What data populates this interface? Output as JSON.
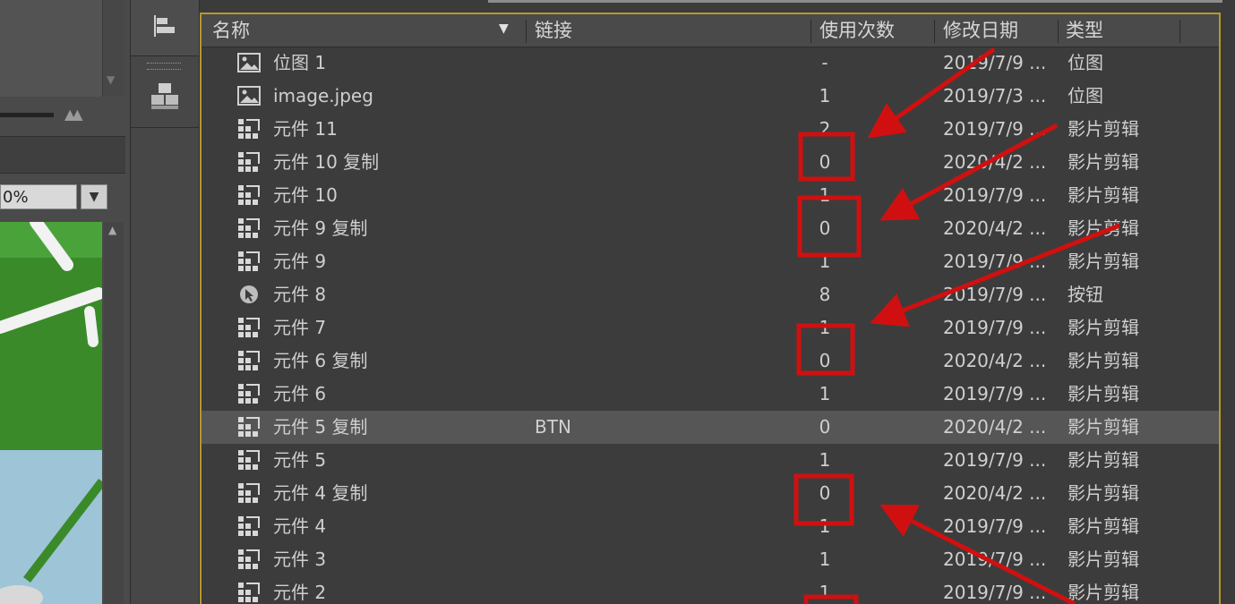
{
  "colors": {
    "panel_border": "#b8962e",
    "annotation_red": "#d01010",
    "selected_row": "#565656"
  },
  "left_panel": {
    "zoom_value": "0%",
    "zoom_dropdown_icon": "chevron-down-icon"
  },
  "library": {
    "columns": {
      "name": "名称",
      "linkage": "链接",
      "use_count": "使用次数",
      "modified": "修改日期",
      "type": "类型"
    },
    "rows": [
      {
        "icon": "bitmap",
        "name": "位图 1",
        "linkage": "",
        "use_count": "-",
        "modified": "2019/7/9 ...",
        "type": "位图",
        "selected": false
      },
      {
        "icon": "bitmap",
        "name": "image.jpeg",
        "linkage": "",
        "use_count": "1",
        "modified": "2019/7/3 ...",
        "type": "位图",
        "selected": false
      },
      {
        "icon": "movieclip",
        "name": "元件 11",
        "linkage": "",
        "use_count": "2",
        "modified": "2019/7/9 ...",
        "type": "影片剪辑",
        "selected": false
      },
      {
        "icon": "movieclip",
        "name": "元件 10 复制",
        "linkage": "",
        "use_count": "0",
        "modified": "2020/4/2 ...",
        "type": "影片剪辑",
        "selected": false
      },
      {
        "icon": "movieclip",
        "name": "元件 10",
        "linkage": "",
        "use_count": "1",
        "modified": "2019/7/9 ...",
        "type": "影片剪辑",
        "selected": false
      },
      {
        "icon": "movieclip",
        "name": "元件 9 复制",
        "linkage": "",
        "use_count": "0",
        "modified": "2020/4/2 ...",
        "type": "影片剪辑",
        "selected": false
      },
      {
        "icon": "movieclip",
        "name": "元件 9",
        "linkage": "",
        "use_count": "1",
        "modified": "2019/7/9 ...",
        "type": "影片剪辑",
        "selected": false
      },
      {
        "icon": "button",
        "name": "元件 8",
        "linkage": "",
        "use_count": "8",
        "modified": "2019/7/9 ...",
        "type": "按钮",
        "selected": false
      },
      {
        "icon": "movieclip",
        "name": "元件 7",
        "linkage": "",
        "use_count": "1",
        "modified": "2019/7/9 ...",
        "type": "影片剪辑",
        "selected": false
      },
      {
        "icon": "movieclip",
        "name": "元件 6 复制",
        "linkage": "",
        "use_count": "0",
        "modified": "2020/4/2 ...",
        "type": "影片剪辑",
        "selected": false
      },
      {
        "icon": "movieclip",
        "name": "元件 6",
        "linkage": "",
        "use_count": "1",
        "modified": "2019/7/9 ...",
        "type": "影片剪辑",
        "selected": false
      },
      {
        "icon": "movieclip",
        "name": "元件 5 复制",
        "linkage": "BTN",
        "use_count": "0",
        "modified": "2020/4/2 ...",
        "type": "影片剪辑",
        "selected": true
      },
      {
        "icon": "movieclip",
        "name": "元件 5",
        "linkage": "",
        "use_count": "1",
        "modified": "2019/7/9 ...",
        "type": "影片剪辑",
        "selected": false
      },
      {
        "icon": "movieclip",
        "name": "元件 4 复制",
        "linkage": "",
        "use_count": "0",
        "modified": "2020/4/2 ...",
        "type": "影片剪辑",
        "selected": false
      },
      {
        "icon": "movieclip",
        "name": "元件 4",
        "linkage": "",
        "use_count": "1",
        "modified": "2019/7/9 ...",
        "type": "影片剪辑",
        "selected": false
      },
      {
        "icon": "movieclip",
        "name": "元件 3",
        "linkage": "",
        "use_count": "1",
        "modified": "2019/7/9 ...",
        "type": "影片剪辑",
        "selected": false
      },
      {
        "icon": "movieclip",
        "name": "元件 2",
        "linkage": "",
        "use_count": "1",
        "modified": "2019/7/9 ...",
        "type": "影片剪辑",
        "selected": false
      }
    ]
  }
}
